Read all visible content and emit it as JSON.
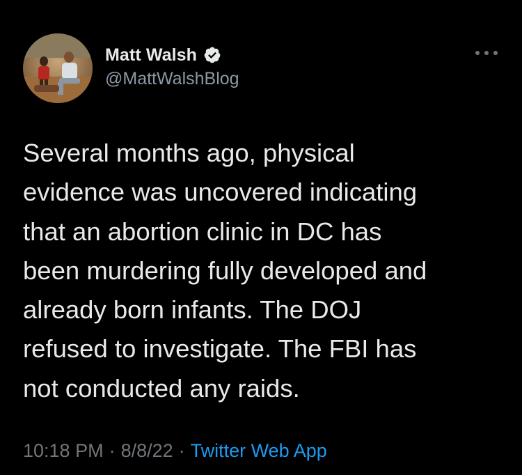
{
  "tweet": {
    "author": {
      "display_name": "Matt Walsh",
      "handle": "@MattWalshBlog",
      "verified": true,
      "avatar": "profile-photo"
    },
    "text": "Several months ago, physical\nevidence was uncovered indicating\nthat an abortion clinic in DC has\nbeen murdering fully developed and\nalready born infants. The DOJ\nrefused to investigate. The FBI has\nnot conducted any raids.",
    "time": "10:18 PM",
    "date": "8/8/22",
    "separator": "·",
    "source": "Twitter Web App",
    "more_icon": "more-options-icon"
  },
  "colors": {
    "background": "#000000",
    "text_primary": "#e7e9ea",
    "text_secondary": "#71767b",
    "link": "#1d9bf0",
    "verified_badge": "#e7e9ea"
  }
}
